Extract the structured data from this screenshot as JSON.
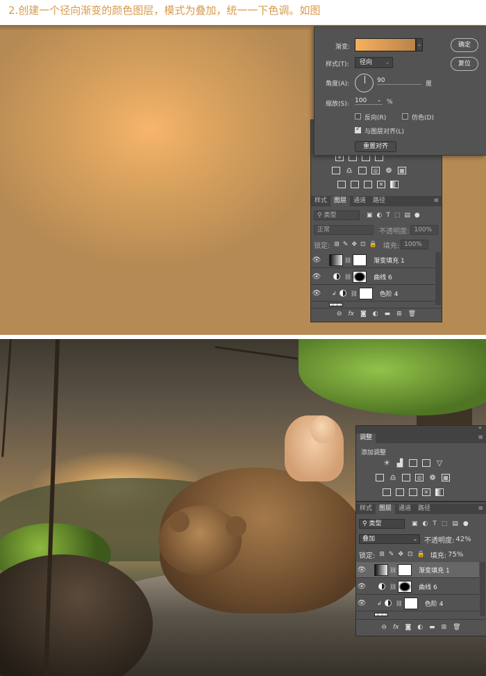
{
  "caption": "2.创建一个径向渐变的颜色图层，模式为叠加，统一一下色调。如图",
  "gradient_dialog": {
    "gradient_label": "渐变:",
    "style_label": "样式(T):",
    "style_value": "径向",
    "angle_label": "角度(A):",
    "angle_value": "90",
    "angle_unit": "度",
    "scale_label": "缩放(S):",
    "scale_value": "100",
    "scale_unit": "%",
    "reverse_label": "反向(R)",
    "dither_label": "仿色(D)",
    "align_label": "与图层对齐(L)",
    "reset_align_label": "重置对齐",
    "ok_label": "确定",
    "reset_label": "复位",
    "gradient_colors": [
      "#f8b05e",
      "#b8844a"
    ]
  },
  "top_panel": {
    "tabs": [
      "样式",
      "图层",
      "通道",
      "路径"
    ],
    "active_tab": "图层",
    "filter_kind": "类型",
    "blend_mode": "正常",
    "opacity_label": "不透明度:",
    "opacity_value": "100%",
    "lock_label": "锁定:",
    "fill_label": "填充:",
    "fill_value": "100%",
    "layers": [
      {
        "name": "渐变填充 1",
        "selected": false
      },
      {
        "name": "曲线 6",
        "selected": false
      },
      {
        "name": "色阶 4",
        "selected": false
      }
    ]
  },
  "bottom_panel": {
    "header_title": "调整",
    "add_adjustment": "添加调整",
    "tabs": [
      "样式",
      "图层",
      "通道",
      "路径"
    ],
    "active_tab": "图层",
    "filter_kind": "类型",
    "blend_mode": "叠加",
    "opacity_label": "不透明度:",
    "opacity_value": "42%",
    "lock_label": "锁定:",
    "fill_label": "填充:",
    "fill_value": "75%",
    "layers": [
      {
        "name": "渐变填充 1",
        "selected": true
      },
      {
        "name": "曲线 6",
        "selected": false
      },
      {
        "name": "色阶 4",
        "selected": false
      }
    ]
  },
  "icons": {
    "adjust_row1": [
      "brightness-icon",
      "levels-icon",
      "curves-icon",
      "exposure-icon",
      "vibrance-icon"
    ],
    "adjust_row2": [
      "hue-sat-icon",
      "color-balance-icon",
      "black-white-icon",
      "photo-filter-icon",
      "channel-mixer-icon",
      "color-lookup-icon"
    ],
    "adjust_row3": [
      "invert-icon",
      "posterize-icon",
      "threshold-icon",
      "selective-color-icon",
      "gradient-map-icon"
    ],
    "bottom_bar": [
      "link-icon",
      "fx-icon",
      "mask-icon",
      "adjustment-icon",
      "folder-icon",
      "new-layer-icon",
      "trash-icon"
    ]
  }
}
